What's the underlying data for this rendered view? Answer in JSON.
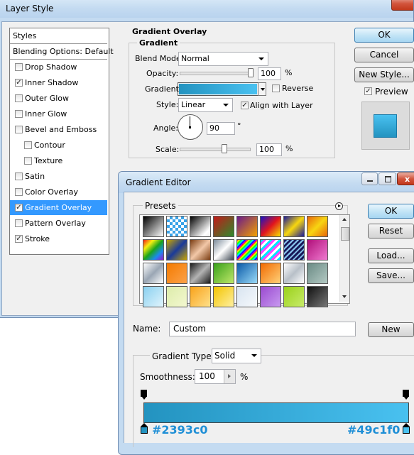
{
  "layer_style": {
    "title": "Layer Style",
    "styles_list": [
      {
        "label": "Styles",
        "checkbox": false,
        "checked": false,
        "indent": false,
        "selected": false
      },
      {
        "label": "Blending Options: Default",
        "checkbox": false,
        "checked": false,
        "indent": false,
        "selected": false
      },
      {
        "label": "Drop Shadow",
        "checkbox": true,
        "checked": false,
        "indent": false,
        "selected": false
      },
      {
        "label": "Inner Shadow",
        "checkbox": true,
        "checked": true,
        "indent": false,
        "selected": false
      },
      {
        "label": "Outer Glow",
        "checkbox": true,
        "checked": false,
        "indent": false,
        "selected": false
      },
      {
        "label": "Inner Glow",
        "checkbox": true,
        "checked": false,
        "indent": false,
        "selected": false
      },
      {
        "label": "Bevel and Emboss",
        "checkbox": true,
        "checked": false,
        "indent": false,
        "selected": false
      },
      {
        "label": "Contour",
        "checkbox": true,
        "checked": false,
        "indent": true,
        "selected": false
      },
      {
        "label": "Texture",
        "checkbox": true,
        "checked": false,
        "indent": true,
        "selected": false
      },
      {
        "label": "Satin",
        "checkbox": true,
        "checked": false,
        "indent": false,
        "selected": false
      },
      {
        "label": "Color Overlay",
        "checkbox": true,
        "checked": false,
        "indent": false,
        "selected": false
      },
      {
        "label": "Gradient Overlay",
        "checkbox": true,
        "checked": true,
        "indent": false,
        "selected": true
      },
      {
        "label": "Pattern Overlay",
        "checkbox": true,
        "checked": false,
        "indent": false,
        "selected": false
      },
      {
        "label": "Stroke",
        "checkbox": true,
        "checked": true,
        "indent": false,
        "selected": false
      }
    ],
    "section_title": "Gradient Overlay",
    "group_title": "Gradient",
    "blend_mode_label": "Blend Mode:",
    "blend_mode_value": "Normal",
    "opacity_label": "Opacity:",
    "opacity_value": "100",
    "opacity_slider": 1.0,
    "percent": "%",
    "gradient_label": "Gradient:",
    "reverse_label": "Reverse",
    "reverse_checked": false,
    "style_label": "Style:",
    "style_value": "Linear",
    "align_label": "Align with Layer",
    "align_checked": true,
    "angle_label": "Angle:",
    "angle_value": "90",
    "degree": "°",
    "scale_label": "Scale:",
    "scale_value": "100",
    "scale_slider": 0.6,
    "ok": "OK",
    "cancel": "Cancel",
    "new_style": "New Style...",
    "preview_label": "Preview",
    "preview_checked": true
  },
  "gradient_editor": {
    "title": "Gradient Editor",
    "presets_label": "Presets",
    "ok": "OK",
    "reset": "Reset",
    "load": "Load...",
    "save": "Save...",
    "name_label": "Name:",
    "name_value": "Custom",
    "new": "New",
    "type_label": "Gradient Type:",
    "type_value": "Solid",
    "smoothness_label": "Smoothness:",
    "smoothness_value": "100",
    "percent": "%",
    "stop_left_color": "#2393c0",
    "stop_right_color": "#49c1f0",
    "stop_left_label": "#2393c0",
    "stop_right_label": "#49c1f0"
  },
  "colors": {
    "gradient_start": "#2393c0",
    "gradient_end": "#49c1f0",
    "selection": "#3399ff",
    "label_blue": "#1f8fd6"
  }
}
